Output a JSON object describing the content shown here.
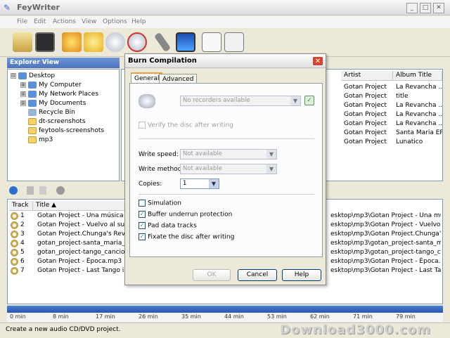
{
  "app": {
    "title": "FeyWriter"
  },
  "window_buttons": {
    "minimize": "_",
    "maximize": "□",
    "close": "✕"
  },
  "menu": [
    "File",
    "Edit",
    "Actions",
    "View",
    "Options",
    "Help"
  ],
  "explorer": {
    "header": "Explorer View",
    "items": [
      {
        "label": "Desktop",
        "level": 0,
        "icon": "desktop-icon",
        "expander": "⊟"
      },
      {
        "label": "My Computer",
        "level": 1,
        "icon": "computer-icon",
        "expander": "⊞"
      },
      {
        "label": "My Network Places",
        "level": 1,
        "icon": "network-icon",
        "expander": "⊞"
      },
      {
        "label": "My Documents",
        "level": 1,
        "icon": "documents-icon",
        "expander": "⊞"
      },
      {
        "label": "Recycle Bin",
        "level": 1,
        "icon": "recycle-bin-icon",
        "expander": ""
      },
      {
        "label": "dt-screenshots",
        "level": 1,
        "icon": "folder-icon",
        "expander": ""
      },
      {
        "label": "feytools-screenshots",
        "level": 1,
        "icon": "folder-icon",
        "expander": ""
      },
      {
        "label": "mp3",
        "level": 1,
        "icon": "folder-icon",
        "expander": ""
      }
    ]
  },
  "file_list": {
    "columns": [
      "Artist",
      "Album Title"
    ],
    "rows": [
      [
        "Gotan Project",
        "La Revancha ..."
      ],
      [
        "Gotan Project",
        "title"
      ],
      [
        "Gotan Project",
        "La Revancha ..."
      ],
      [
        "Gotan Project",
        "La Revancha ..."
      ],
      [
        "Gotan Project",
        "La Revancha ..."
      ],
      [
        "Gotan Project",
        "Santa Maria EP"
      ],
      [
        "Gotan Project",
        "Lunatico"
      ]
    ]
  },
  "tracks": {
    "columns": [
      "Track",
      "Title"
    ],
    "rows": [
      {
        "num": "1",
        "title": "Gotan Project - Una música bruta",
        "path": "esktop\\mp3\\Gotan Project - Una músi..."
      },
      {
        "num": "2",
        "title": "Gotan Project - Vuelvo al sur.mp3",
        "path": "esktop\\mp3\\Gotan Project - Vuelvo al s..."
      },
      {
        "num": "3",
        "title": "Gotan Project.Chunga's Revenge",
        "path": "esktop\\mp3\\Gotan Project.Chunga's Re..."
      },
      {
        "num": "4",
        "title": "gotan_project-santa_maria_(del",
        "path": "esktop\\mp3\\gotan_project-santa_mar..."
      },
      {
        "num": "5",
        "title": "gotan_project-tango_cancion.mp",
        "path": "esktop\\mp3\\gotan_project-tango_canc..."
      },
      {
        "num": "6",
        "title": "Gotan Project - Época.mp3",
        "path": "esktop\\mp3\\Gotan Project - Época.mp3"
      },
      {
        "num": "7",
        "title": "Gotan Project - Last Tango in Pa",
        "path": "esktop\\mp3\\Gotan Project - Last Tango..."
      }
    ]
  },
  "timeline": [
    "0 min",
    "8 min",
    "17 min",
    "26 min",
    "35 min",
    "44 min",
    "53 min",
    "62 min",
    "71 min",
    "79 min"
  ],
  "status": {
    "text": "Create a new audio CD/DVD project."
  },
  "watermark": "Download3000.com",
  "dialog": {
    "title": "Burn Compilation",
    "tabs": [
      "General",
      "Advanced"
    ],
    "recorder": {
      "value": "No recorders available"
    },
    "verify_label": "Verify the disc after writing",
    "write_speed": {
      "label": "Write speed:",
      "value": "Not available"
    },
    "write_method": {
      "label": "Write method:",
      "value": "Not available"
    },
    "copies": {
      "label": "Copies:",
      "value": "1"
    },
    "options": [
      {
        "label": "Simulation",
        "checked": false
      },
      {
        "label": "Buffer underrun protection",
        "checked": true
      },
      {
        "label": "Pad data tracks",
        "checked": true
      },
      {
        "label": "Fixate the disc after writing",
        "checked": true
      }
    ],
    "buttons": {
      "ok": "OK",
      "cancel": "Cancel",
      "help": "Help"
    }
  },
  "colors": {
    "accent": "#4b74c0",
    "close_red": "#d9422b",
    "check_green": "#21a121"
  }
}
